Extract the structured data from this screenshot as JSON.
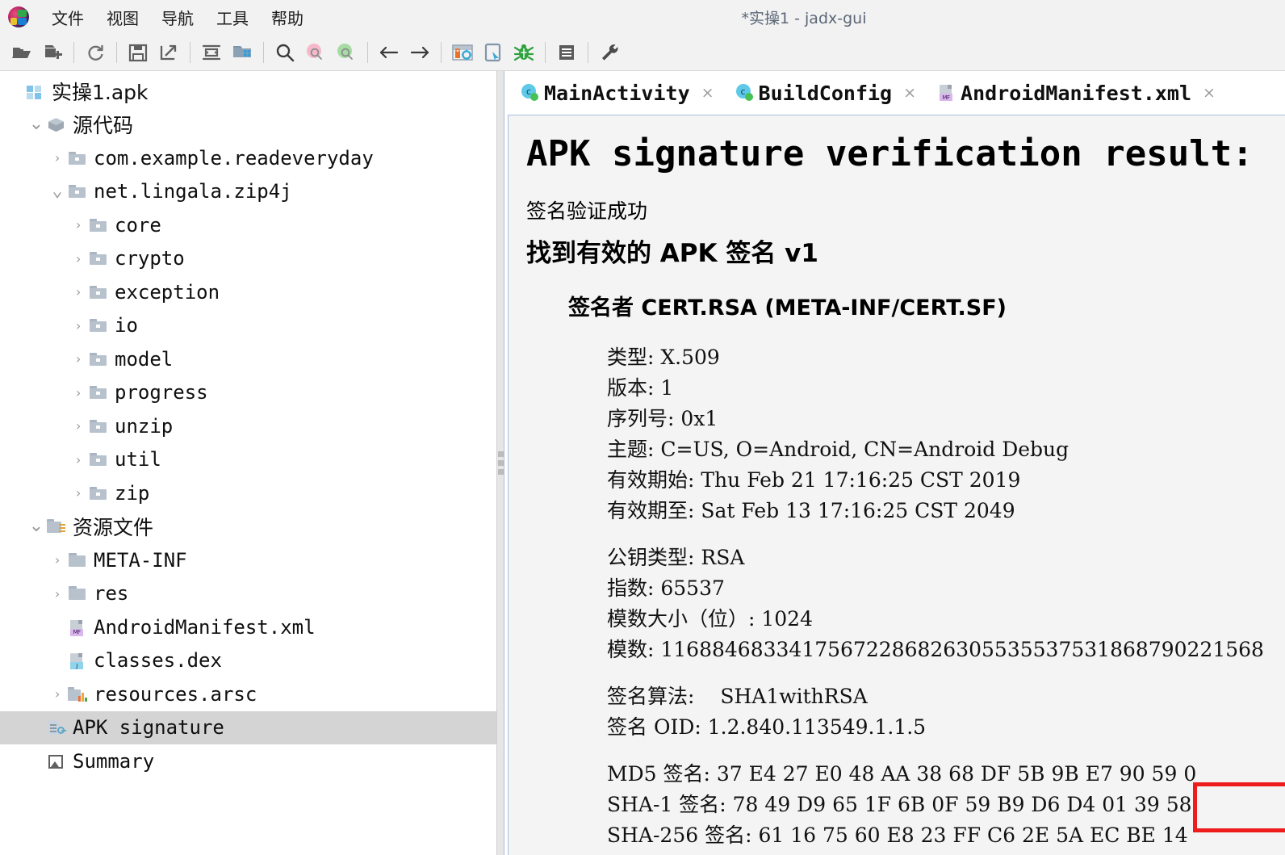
{
  "window": {
    "title": "*实操1 - jadx-gui"
  },
  "menubar": {
    "logo_name": "jadx-logo",
    "items": [
      {
        "label": "文件",
        "name": "menu-file"
      },
      {
        "label": "视图",
        "name": "menu-view"
      },
      {
        "label": "导航",
        "name": "menu-navigate"
      },
      {
        "label": "工具",
        "name": "menu-tools"
      },
      {
        "label": "帮助",
        "name": "menu-help"
      }
    ]
  },
  "toolbar": {
    "buttons": [
      {
        "name": "open-file-icon",
        "glyph": "folder-open"
      },
      {
        "name": "add-files-icon",
        "glyph": "folder-add"
      },
      {
        "sep": true
      },
      {
        "name": "reload-icon",
        "glyph": "reload"
      },
      {
        "sep": true
      },
      {
        "name": "save-all-icon",
        "glyph": "save"
      },
      {
        "name": "export-gradle-icon",
        "glyph": "export"
      },
      {
        "sep": true
      },
      {
        "name": "sync-icon",
        "glyph": "sync-horizontal"
      },
      {
        "name": "flat-packages-icon",
        "glyph": "folder-grid"
      },
      {
        "sep": true
      },
      {
        "name": "search-icon",
        "glyph": "search"
      },
      {
        "name": "search-back-icon",
        "glyph": "search-pink"
      },
      {
        "name": "search-forward-icon",
        "glyph": "search-green"
      },
      {
        "sep": true
      },
      {
        "name": "back-icon",
        "glyph": "arrow-left"
      },
      {
        "name": "forward-icon",
        "glyph": "arrow-right"
      },
      {
        "sep": true
      },
      {
        "name": "deobfuscation-icon",
        "glyph": "lock-gear"
      },
      {
        "name": "open-device-icon",
        "glyph": "device"
      },
      {
        "name": "debugger-icon",
        "glyph": "bug"
      },
      {
        "sep": true
      },
      {
        "name": "logs-icon",
        "glyph": "log"
      },
      {
        "sep": true
      },
      {
        "name": "preferences-icon",
        "glyph": "wrench"
      }
    ]
  },
  "sidebar": {
    "rows": [
      {
        "label": "实操1.apk",
        "indent": 0,
        "twisty": "none",
        "icon": "apk",
        "cjk": true,
        "name": "tree-item-apk-root"
      },
      {
        "label": "源代码",
        "indent": 1,
        "twisty": "open",
        "icon": "cube",
        "cjk": true,
        "name": "tree-item-source-code"
      },
      {
        "label": "com.example.readeveryday",
        "indent": 2,
        "twisty": "closed",
        "icon": "folder",
        "cjk": false,
        "name": "tree-item-com-example-readeveryday"
      },
      {
        "label": "net.lingala.zip4j",
        "indent": 2,
        "twisty": "open",
        "icon": "folder",
        "cjk": false,
        "name": "tree-item-net-lingala-zip4j"
      },
      {
        "label": "core",
        "indent": 3,
        "twisty": "closed",
        "icon": "folder",
        "cjk": false,
        "name": "tree-item-core"
      },
      {
        "label": "crypto",
        "indent": 3,
        "twisty": "closed",
        "icon": "folder",
        "cjk": false,
        "name": "tree-item-crypto"
      },
      {
        "label": "exception",
        "indent": 3,
        "twisty": "closed",
        "icon": "folder",
        "cjk": false,
        "name": "tree-item-exception"
      },
      {
        "label": "io",
        "indent": 3,
        "twisty": "closed",
        "icon": "folder",
        "cjk": false,
        "name": "tree-item-io"
      },
      {
        "label": "model",
        "indent": 3,
        "twisty": "closed",
        "icon": "folder",
        "cjk": false,
        "name": "tree-item-model"
      },
      {
        "label": "progress",
        "indent": 3,
        "twisty": "closed",
        "icon": "folder",
        "cjk": false,
        "name": "tree-item-progress"
      },
      {
        "label": "unzip",
        "indent": 3,
        "twisty": "closed",
        "icon": "folder",
        "cjk": false,
        "name": "tree-item-unzip"
      },
      {
        "label": "util",
        "indent": 3,
        "twisty": "closed",
        "icon": "folder",
        "cjk": false,
        "name": "tree-item-util"
      },
      {
        "label": "zip",
        "indent": 3,
        "twisty": "closed",
        "icon": "folder",
        "cjk": false,
        "name": "tree-item-zip"
      },
      {
        "label": "资源文件",
        "indent": 1,
        "twisty": "open",
        "icon": "resfolder",
        "cjk": true,
        "name": "tree-item-resources"
      },
      {
        "label": "META-INF",
        "indent": 2,
        "twisty": "closed",
        "icon": "folder-plain",
        "cjk": false,
        "name": "tree-item-meta-inf"
      },
      {
        "label": "res",
        "indent": 2,
        "twisty": "closed",
        "icon": "folder-plain",
        "cjk": false,
        "name": "tree-item-res"
      },
      {
        "label": "AndroidManifest.xml",
        "indent": 2,
        "twisty": "none",
        "icon": "xml",
        "cjk": false,
        "name": "tree-item-androidmanifest-xml"
      },
      {
        "label": "classes.dex",
        "indent": 2,
        "twisty": "none",
        "icon": "dex",
        "cjk": false,
        "name": "tree-item-classes-dex"
      },
      {
        "label": "resources.arsc",
        "indent": 2,
        "twisty": "closed",
        "icon": "arsc",
        "cjk": false,
        "name": "tree-item-resources-arsc"
      },
      {
        "label": "APK signature",
        "indent": 1,
        "twisty": "none",
        "icon": "sig",
        "cjk": false,
        "name": "tree-item-apk-signature",
        "selected": true
      },
      {
        "label": "Summary",
        "indent": 1,
        "twisty": "none",
        "icon": "summary",
        "cjk": false,
        "name": "tree-item-summary"
      }
    ],
    "icon_badges": {
      "xml": "MF",
      "dex": "J"
    }
  },
  "tabs": [
    {
      "label": "MainActivity",
      "icon": "java-class-icon",
      "close": "×",
      "name": "tab-mainactivity",
      "active": false
    },
    {
      "label": "BuildConfig",
      "icon": "java-class-icon",
      "close": "×",
      "name": "tab-buildconfig",
      "active": false
    },
    {
      "label": "AndroidManifest.xml",
      "icon": "xml-file-icon",
      "close": "×",
      "name": "tab-androidmanifest-xml",
      "active": true
    }
  ],
  "editor": {
    "heading": "APK signature verification result:",
    "status": "签名验证成功",
    "subheading": "找到有效的 APK 签名 v1",
    "signer": "签名者 CERT.RSA (META-INF/CERT.SF)",
    "cert_lines": [
      "类型: X.509",
      "版本: 1",
      "序列号: 0x1",
      "主题: C=US, O=Android, CN=Android Debug",
      "有效期始: Thu Feb 21 17:16:25 CST 2019",
      "有效期至: Sat Feb 13 17:16:25 CST 2049"
    ],
    "key_lines": [
      "公钥类型: RSA",
      "指数: 65537",
      "模数大小（位）: 1024",
      "模数: 11688468334175672286826305535537531868790221568"
    ],
    "algo_label": "签名算法:",
    "algo_value": "SHA1withRSA",
    "oid_line": "签名 OID: 1.2.840.113549.1.1.5",
    "hash_lines": [
      "MD5 签名: 37 E4 27 E0 48 AA 38 68 DF 5B 9B E7 90 59 0",
      "SHA-1 签名: 78 49 D9 65 1F 6B 0F 59 B9 D6 D4 01 39 58",
      "SHA-256 签名: 61 16 75 60 E8 23 FF C6 2E 5A EC BE 14"
    ],
    "highlight_color": "#ee1c1c"
  }
}
